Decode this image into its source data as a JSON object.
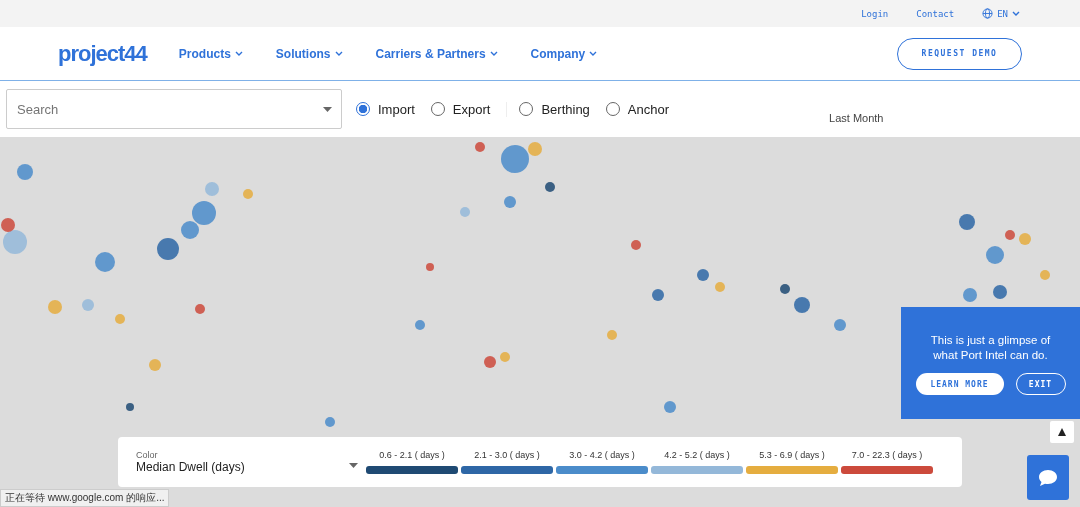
{
  "top_bar": {
    "links": [
      "Login",
      "Contact"
    ],
    "language": "EN"
  },
  "nav": {
    "logo": "project44",
    "items": [
      {
        "label": "Products"
      },
      {
        "label": "Solutions"
      },
      {
        "label": "Carriers & Partners"
      },
      {
        "label": "Company"
      }
    ],
    "cta": "REQUEST DEMO"
  },
  "filters": {
    "search": {
      "placeholder": "Search"
    },
    "options": [
      {
        "label": "Import",
        "selected": true
      },
      {
        "label": "Export",
        "selected": false
      },
      {
        "label": "Berthing",
        "selected": false
      },
      {
        "label": "Anchor",
        "selected": false
      }
    ],
    "period": "Last Month"
  },
  "legend": {
    "caption": "Color",
    "value": "Median Dwell (days)",
    "ranges": [
      {
        "label": "0.6 - 2.1 ( days )",
        "color": "#1f4a73"
      },
      {
        "label": "2.1 - 3.0 ( days )",
        "color": "#2e67a6"
      },
      {
        "label": "3.0 - 4.2 ( days )",
        "color": "#4b8cca"
      },
      {
        "label": "4.2 - 5.2 ( days )",
        "color": "#94b8d9"
      },
      {
        "label": "5.3 - 6.9 ( days )",
        "color": "#e5ad3f"
      },
      {
        "label": "7.0 - 22.3 ( days )",
        "color": "#cc4a3c"
      }
    ]
  },
  "promo": {
    "text": "This is just a glimpse of what Port Intel can do.",
    "buttons": [
      "LEARN MORE",
      "EXIT"
    ]
  },
  "status_bar": "正在等待 www.google.com 的响应..."
}
